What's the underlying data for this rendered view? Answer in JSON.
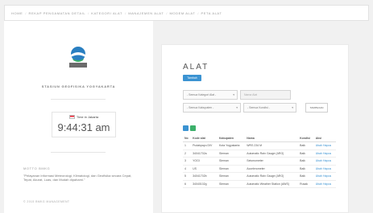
{
  "nav": [
    "HOME",
    "REKAP PENGAMATAN DETAIL",
    "KATEGORI ALAT",
    "MANAJEMEN ALAT",
    "MODEM ALAT",
    "PETA ALAT"
  ],
  "sidebar": {
    "logo_text": "BMKG",
    "station_name": "STASIUN GEOFISIKA YOGYAKARTA",
    "timezone_label": "Time in Jakarta",
    "clock_time": "9:44:31 am",
    "motto_title": "MOTTO BMKG",
    "motto_text": "\"Pelayanan Informasi Meteorologi, Klimatologi, dan Geofisika secara Cepat, Tepat, Akurat, Luas, dan Mudah dipahami.\"",
    "footer_text": "© 2015 BMKG MANAGEMENT"
  },
  "main": {
    "title": "ALAT",
    "add_button": "Tambah",
    "filters": {
      "kategori": "- Semua Kategori Alat -",
      "nama_placeholder": "Nama Alat",
      "kabupaten": "- Semua Kabupaten -",
      "kondisi": "- Semua Kondisi -",
      "search_button": "TAMPILKAN"
    },
    "table": {
      "headers": [
        "No",
        "Kode alat",
        "Kabupaten",
        "Nama",
        "Kondisi",
        "Aksi"
      ],
      "rows": [
        [
          "1",
          "Pudakpayu DIV",
          "Kota Yogyakarta",
          "WRS 234 M",
          "Baik",
          "Ubah Hapus"
        ],
        [
          "2",
          "34041702a",
          "Sleman",
          "Automatic Rain Gauge (ARG)",
          "Baik",
          "Ubah Hapus"
        ],
        [
          "3",
          "YOGI",
          "Sleman",
          "Seismometer",
          "Baik",
          "Ubah Hapus"
        ],
        [
          "4",
          "US",
          "Sleman",
          "Accelerometer",
          "Baik",
          "Ubah Hapus"
        ],
        [
          "5",
          "34041702b",
          "Sleman",
          "Automatic Rain Gauge (ARG)",
          "Baik",
          "Ubah Hapus"
        ],
        [
          "6",
          "34040102g",
          "Sleman",
          "Automatic Weather Station (AWS)",
          "Rusak",
          "Ubah Hapus"
        ]
      ]
    }
  },
  "colors": {
    "accent_blue": "#3b93d2",
    "accent_green": "#3cb06a",
    "background": "#f1f1f1"
  }
}
